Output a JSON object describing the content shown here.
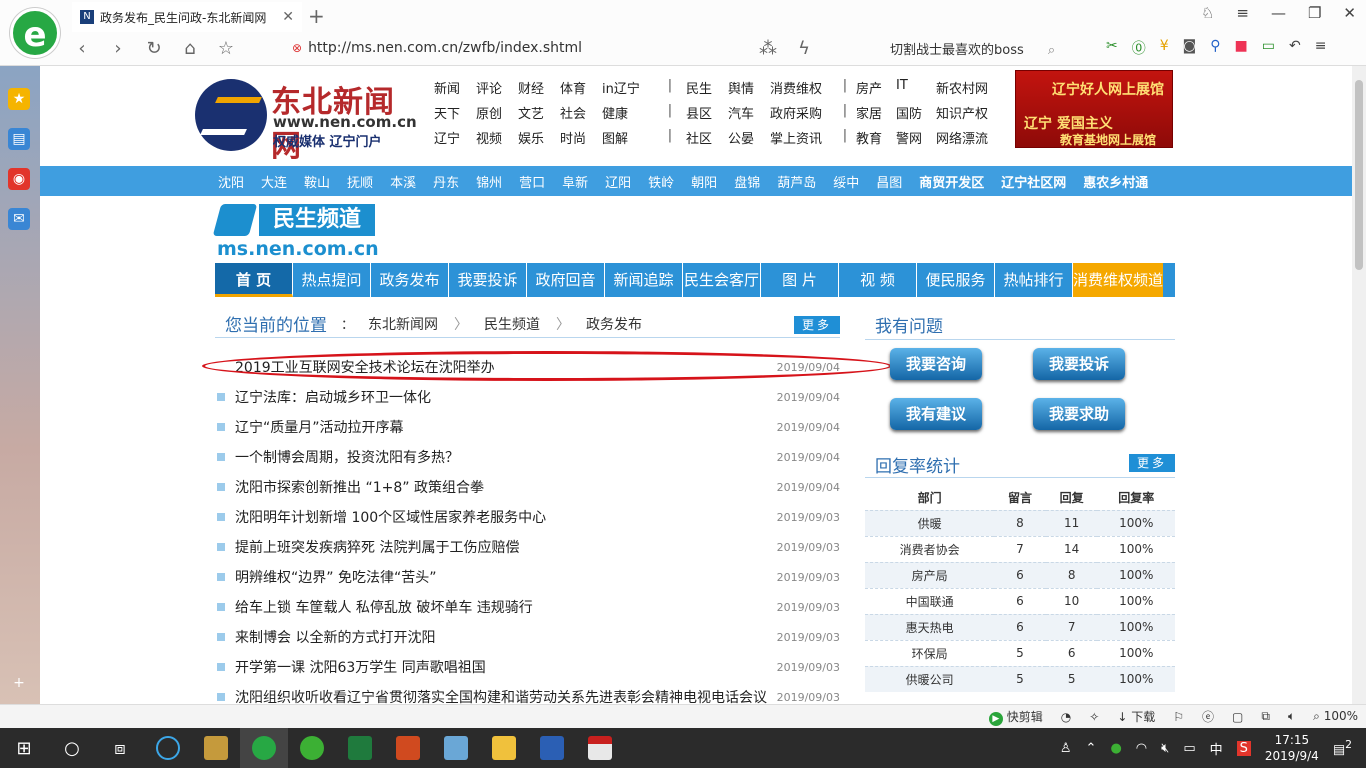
{
  "browser": {
    "tab_title": "政务发布_民生问政-东北新闻网",
    "url": "http://ms.nen.com.cn/zwfb/index.shtml",
    "search_text": "切割战士最喜欢的boss",
    "zoom": "100%",
    "status_items": [
      "快剪辑",
      "下载"
    ]
  },
  "site": {
    "name": "东北新闻网",
    "domain": "www.nen.com.cn",
    "slogan": "权威媒体 辽宁门户",
    "banner": {
      "line1": "辽宁好人网上展馆",
      "line2": "辽宁 爱国主义",
      "line3": "教育基地网上展馆"
    },
    "topnav": [
      [
        "新闻",
        "评论",
        "财经",
        "体育",
        "in辽宁",
        "|",
        "民生",
        "舆情",
        "消费维权",
        "|",
        "房产",
        "IT",
        "新农村网"
      ],
      [
        "天下",
        "原创",
        "文艺",
        "社会",
        "健康",
        "|",
        "县区",
        "汽车",
        "政府采购",
        "|",
        "家居",
        "国防",
        "知识产权"
      ],
      [
        "辽宁",
        "视频",
        "娱乐",
        "时尚",
        "图解",
        "|",
        "社区",
        "公晏",
        "掌上资讯",
        "|",
        "教育",
        "警网",
        "网络漂流"
      ]
    ],
    "cities": [
      "沈阳",
      "大连",
      "鞍山",
      "抚顺",
      "本溪",
      "丹东",
      "锦州",
      "营口",
      "阜新",
      "辽阳",
      "铁岭",
      "朝阳",
      "盘锦",
      "葫芦岛",
      "绥中",
      "昌图"
    ],
    "cities_bold": [
      "商贸开发区",
      "辽宁社区网",
      "惠农乡村通"
    ]
  },
  "channel": {
    "name": "民生频道",
    "domain": "ms.nen.com.cn",
    "nav": [
      "首 页",
      "热点提问",
      "政务发布",
      "我要投诉",
      "政府回音",
      "新闻追踪",
      "民生会客厅",
      "图 片",
      "视 频",
      "便民服务",
      "热帖排行",
      "消费维权频道"
    ]
  },
  "breadcrumb": {
    "label": "您当前的位置",
    "colon": "：",
    "items": [
      "东北新闻网",
      "民生频道",
      "政务发布"
    ],
    "more": "更多"
  },
  "news": [
    {
      "title": "2019工业互联网安全技术论坛在沈阳举办",
      "date": "2019/09/04"
    },
    {
      "title": "辽宁法库：启动城乡环卫一体化",
      "date": "2019/09/04"
    },
    {
      "title": "辽宁“质量月”活动拉开序幕",
      "date": "2019/09/04"
    },
    {
      "title": "一个制博会周期，投资沈阳有多热？",
      "date": "2019/09/04"
    },
    {
      "title": "沈阳市探索创新推出 “1+8” 政策组合拳",
      "date": "2019/09/04"
    },
    {
      "title": "沈阳明年计划新增 100个区域性居家养老服务中心",
      "date": "2019/09/03"
    },
    {
      "title": "提前上班突发疾病猝死 法院判属于工伤应赔偿",
      "date": "2019/09/03"
    },
    {
      "title": "明辨维权“边界” 免吃法律“苦头”",
      "date": "2019/09/03"
    },
    {
      "title": "给车上锁 车筐载人 私停乱放 破坏单车 违规骑行",
      "date": "2019/09/03"
    },
    {
      "title": "来制博会 以全新的方式打开沈阳",
      "date": "2019/09/03"
    },
    {
      "title": "开学第一课 沈阳63万学生 同声歌唱祖国",
      "date": "2019/09/03"
    },
    {
      "title": "沈阳组织收听收看辽宁省贯彻落实全国构建和谐劳动关系先进表彰会精神电视电话会议",
      "date": "2019/09/03"
    }
  ],
  "ask": {
    "title": "我有问题",
    "buttons": [
      "我要咨询",
      "我要投诉",
      "我有建议",
      "我要求助"
    ]
  },
  "rates": {
    "title": "回复率统计",
    "more": "更多",
    "headers": [
      "部门",
      "留言",
      "回复",
      "回复率"
    ],
    "rows": [
      [
        "供暖",
        "8",
        "11",
        "100%"
      ],
      [
        "消费者协会",
        "7",
        "14",
        "100%"
      ],
      [
        "房产局",
        "6",
        "8",
        "100%"
      ],
      [
        "中国联通",
        "6",
        "10",
        "100%"
      ],
      [
        "惠天热电",
        "6",
        "7",
        "100%"
      ],
      [
        "环保局",
        "5",
        "6",
        "100%"
      ],
      [
        "供暖公司",
        "5",
        "5",
        "100%"
      ]
    ]
  },
  "taskbar": {
    "time": "17:15",
    "date": "2019/9/4",
    "ime": "中",
    "notify_count": "2"
  },
  "colors": {
    "accent": "#2c92d7",
    "highlight_oval": "#d6131a",
    "consumer_tab": "#f5a800"
  }
}
